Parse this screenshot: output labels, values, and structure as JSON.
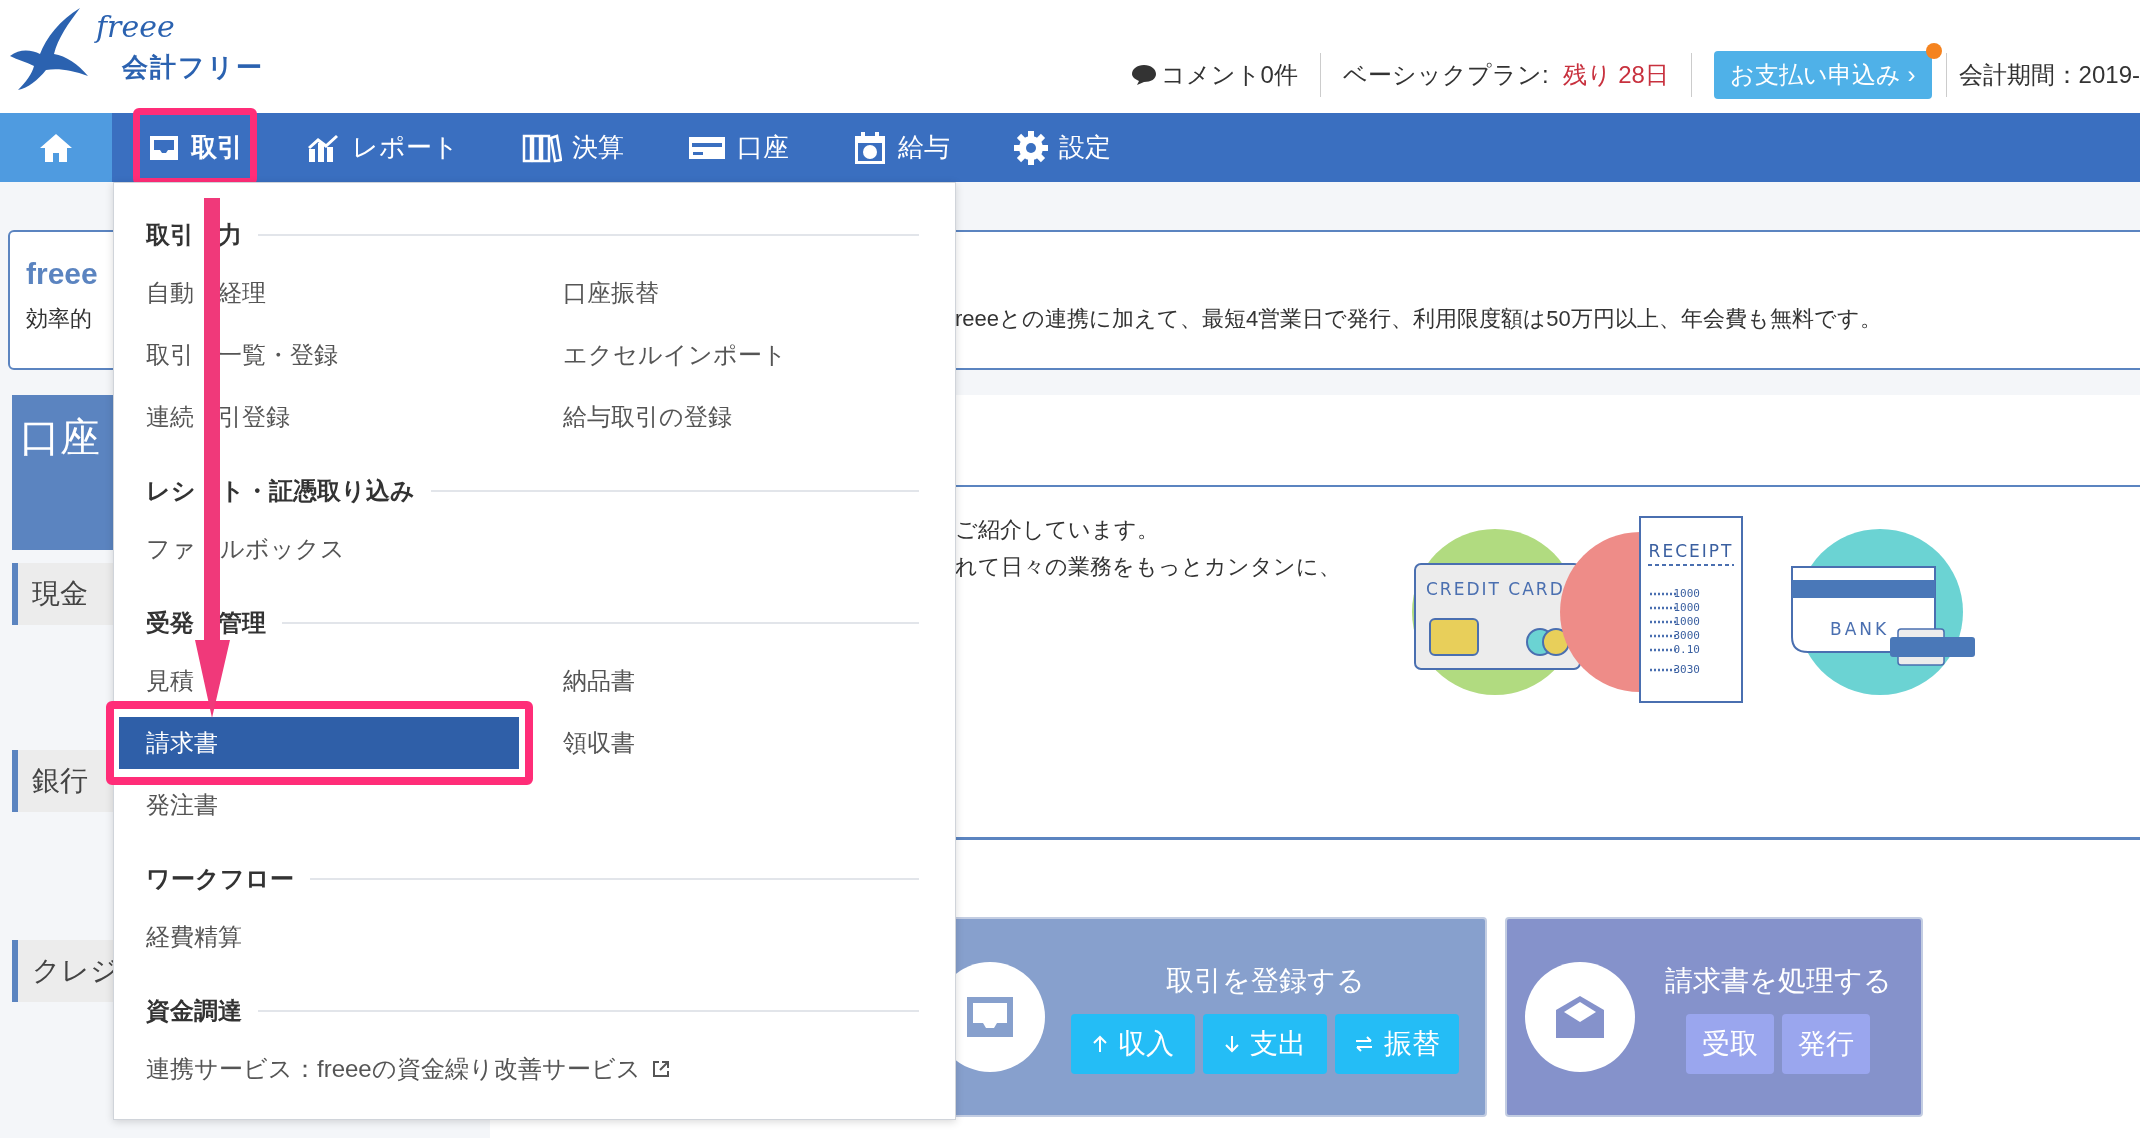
{
  "header": {
    "brand_mark": "freee",
    "brand": "会計フリー",
    "comment": "コメント0件",
    "plan_label": "ベーシックプラン:",
    "plan_remaining": "残り 28日",
    "pay_button": {
      "label": "お支払い申込み",
      "arrow": "›",
      "notification": true
    },
    "fiscal_period": "会計期間：2019-"
  },
  "nav": [
    {
      "kind": "home",
      "selected": false,
      "highlighted": false
    },
    {
      "kind": "deals",
      "label": "取引",
      "selected": true,
      "highlighted": true
    },
    {
      "kind": "report",
      "label": "レポート",
      "selected": false,
      "highlighted": false
    },
    {
      "kind": "closing",
      "label": "決算",
      "selected": false,
      "highlighted": false
    },
    {
      "kind": "account",
      "label": "口座",
      "selected": false,
      "highlighted": false
    },
    {
      "kind": "payroll",
      "label": "給与",
      "selected": false,
      "highlighted": false
    },
    {
      "kind": "settings",
      "label": "設定",
      "selected": false,
      "highlighted": false
    }
  ],
  "banner": {
    "title": "freee",
    "text_left": "効率的",
    "text_right": "reeeとの連携に加えて、最短4営業日で発行、利用限度額は50万円以上、年会費も無料です。"
  },
  "sidebar": {
    "title": "口座",
    "items": [
      "現金",
      "銀行",
      "クレジ"
    ]
  },
  "intro": {
    "lines": [
      "ご紹介しています。",
      "れて日々の業務をもっとカンタンに、"
    ]
  },
  "illustrations": {
    "credit_card": "CREDIT CARD",
    "receipt": {
      "title": "RECEIPT",
      "amounts": [
        "1000",
        "1000",
        "1000",
        "3000",
        "0.10",
        "3030"
      ]
    },
    "bank": "BANK"
  },
  "action_cards": [
    {
      "kind": "deal",
      "title": "取引を登録する",
      "buttons": [
        "収入",
        "支出",
        "振替"
      ]
    },
    {
      "kind": "invoice",
      "title": "請求書を処理する",
      "buttons": [
        "受取",
        "発行"
      ]
    }
  ],
  "dropdown": {
    "annotation_arrow": true,
    "sections": [
      {
        "title": [
          "取引",
          "力"
        ],
        "items": [
          {
            "label": [
              "自動",
              "経理"
            ],
            "selected": false,
            "highlighted": false
          },
          {
            "label": [
              "口座振替"
            ],
            "selected": false,
            "highlighted": false
          },
          {
            "label": [
              "取引",
              "一覧・登録"
            ],
            "selected": false,
            "highlighted": false
          },
          {
            "label": [
              "エクセルインポート"
            ],
            "selected": false,
            "highlighted": false
          },
          {
            "label": [
              "連続",
              "引登録"
            ],
            "selected": false,
            "highlighted": false
          },
          {
            "label": [
              "給与取引の登録"
            ],
            "selected": false,
            "highlighted": false
          }
        ]
      },
      {
        "title": [
          "レシ",
          "ト・証憑取り込み"
        ],
        "items": [
          {
            "label": [
              "ファ",
              "ルボックス"
            ],
            "selected": false,
            "highlighted": false
          }
        ]
      },
      {
        "title": [
          "受発",
          "管理"
        ],
        "items": [
          {
            "label": [
              "見積"
            ],
            "selected": false,
            "highlighted": false
          },
          {
            "label": [
              "納品書"
            ],
            "selected": false,
            "highlighted": false
          },
          {
            "label": [
              "請求書"
            ],
            "selected": true,
            "highlighted": true
          },
          {
            "label": [
              "領収書"
            ],
            "selected": false,
            "highlighted": false
          },
          {
            "label": [
              "発注書"
            ],
            "selected": false,
            "highlighted": false
          }
        ]
      },
      {
        "title": [
          "ワークフロー"
        ],
        "items": [
          {
            "label": [
              "経費精算"
            ],
            "selected": false,
            "highlighted": false
          }
        ]
      },
      {
        "title": [
          "資金調達"
        ],
        "items": [
          {
            "label": [
              "連携サービス：freeeの資金繰り改善サービス"
            ],
            "selected": false,
            "highlighted": false,
            "external": true
          }
        ]
      }
    ]
  }
}
